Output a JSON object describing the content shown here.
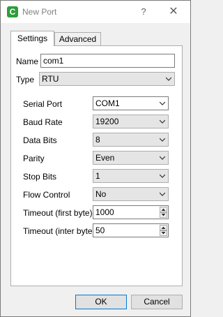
{
  "window": {
    "app_icon_letter": "C",
    "title": "New Port",
    "help_label": "?",
    "close_label": "✕"
  },
  "tabs": [
    {
      "label": "Settings",
      "selected": true
    },
    {
      "label": "Advanced",
      "selected": false
    }
  ],
  "form": {
    "name": {
      "label": "Name",
      "value": "com1"
    },
    "type": {
      "label": "Type",
      "value": "RTU"
    },
    "serial_port": {
      "label": "Serial Port",
      "value": "COM1"
    },
    "baud_rate": {
      "label": "Baud Rate",
      "value": "19200"
    },
    "data_bits": {
      "label": "Data Bits",
      "value": "8"
    },
    "parity": {
      "label": "Parity",
      "value": "Even"
    },
    "stop_bits": {
      "label": "Stop Bits",
      "value": "1"
    },
    "flow_control": {
      "label": "Flow Control",
      "value": "No"
    },
    "timeout_first": {
      "label": "Timeout (first byte)",
      "value": "1000"
    },
    "timeout_inter": {
      "label": "Timeout (inter byte)",
      "value": "50"
    }
  },
  "buttons": {
    "ok": "OK",
    "cancel": "Cancel"
  },
  "colors": {
    "app_icon": "#2e9e3a",
    "default_button_border": "#0078d7"
  }
}
